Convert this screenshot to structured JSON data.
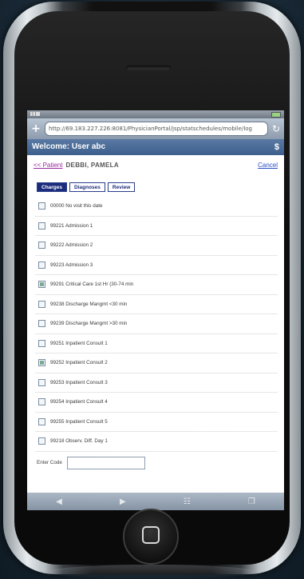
{
  "browser": {
    "url": "http://69.183.227.226:8081/PhysicianPortal/jsp/statschedules/mobile/log"
  },
  "header": {
    "welcome": "Welcome: User abc",
    "currency_symbol": "$"
  },
  "patient": {
    "link_label": "<< Patient",
    "name": "DEBBI, PAMELA",
    "cancel_label": "Cancel"
  },
  "tabs": [
    {
      "label": "Charges",
      "active": true
    },
    {
      "label": "Diagnoses",
      "active": false
    },
    {
      "label": "Review",
      "active": false
    }
  ],
  "codes": [
    {
      "label": "00000 No visit this date",
      "checked": false
    },
    {
      "label": "99221 Admission 1",
      "checked": false
    },
    {
      "label": "99222 Admission 2",
      "checked": false
    },
    {
      "label": "99223 Admission 3",
      "checked": false
    },
    {
      "label": "99291 Critical Care 1st Hr (30-74 min",
      "checked": true
    },
    {
      "label": "99238 Discharge Mangmt <30 min",
      "checked": false
    },
    {
      "label": "99239 Discharge Mangmt >30 min",
      "checked": false
    },
    {
      "label": "99251 Inpatient Consult 1",
      "checked": false
    },
    {
      "label": "99252 Inpatient Consult 2",
      "checked": true
    },
    {
      "label": "99253 Inpatient Consult 3",
      "checked": false
    },
    {
      "label": "99254 Inpatient Consult 4",
      "checked": false
    },
    {
      "label": "99255 Inpatient Consult 5",
      "checked": false
    },
    {
      "label": "99218 Observ. Diff. Day 1",
      "checked": false
    }
  ],
  "enter_code": {
    "label": "Enter Code",
    "value": ""
  },
  "colors": {
    "header_bar": "#4a6c98",
    "tab_active": "#1c2c7c",
    "patient_link": "#9b2aa0",
    "cancel_link": "#2a4fc7"
  }
}
